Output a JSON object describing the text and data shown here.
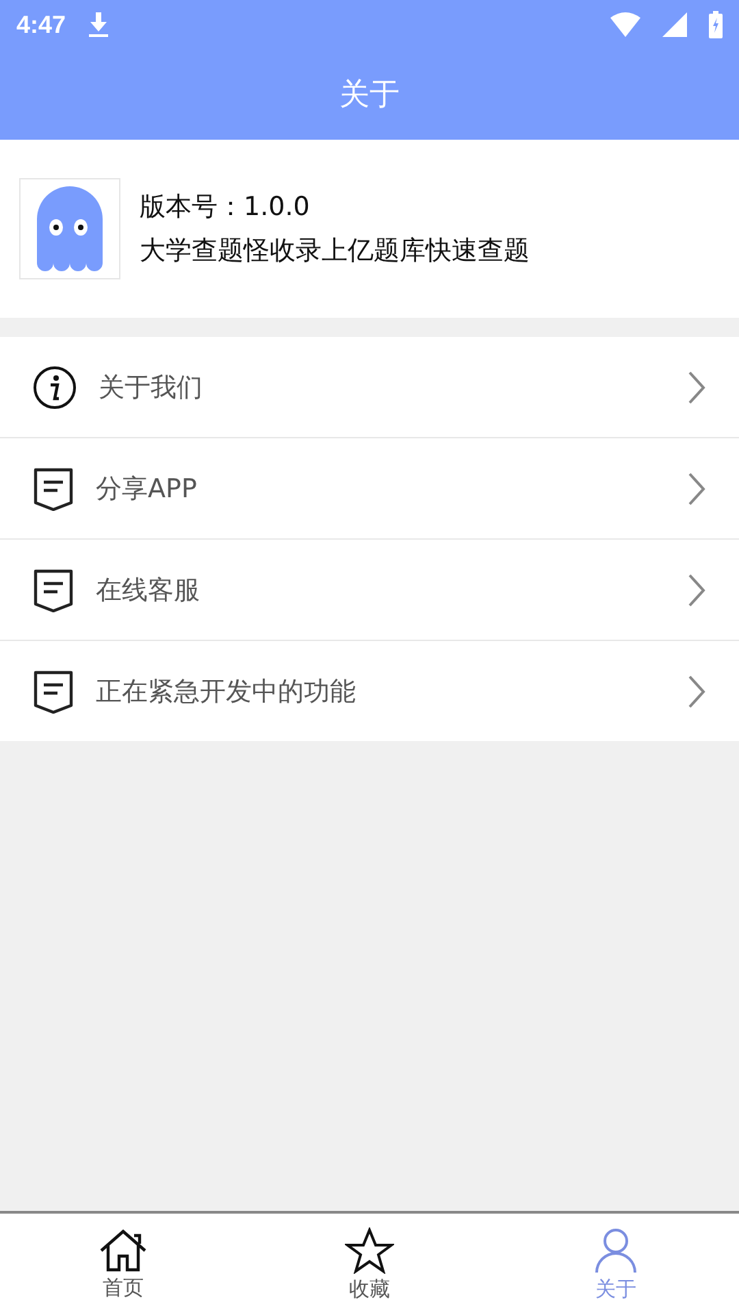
{
  "status_bar": {
    "time": "4:47"
  },
  "header": {
    "title": "关于"
  },
  "app_info": {
    "version": "版本号：1.0.0",
    "description": "大学查题怪收录上亿题库快速查题"
  },
  "menu": [
    {
      "label": "关于我们",
      "kind": "info"
    },
    {
      "label": "分享APP",
      "kind": "note"
    },
    {
      "label": "在线客服",
      "kind": "note"
    },
    {
      "label": "正在紧急开发中的功能",
      "kind": "note"
    }
  ],
  "tabs": [
    {
      "label": "首页",
      "kind": "home",
      "selected": false
    },
    {
      "label": "收藏",
      "kind": "star",
      "selected": false
    },
    {
      "label": "关于",
      "kind": "person",
      "selected": true
    }
  ]
}
